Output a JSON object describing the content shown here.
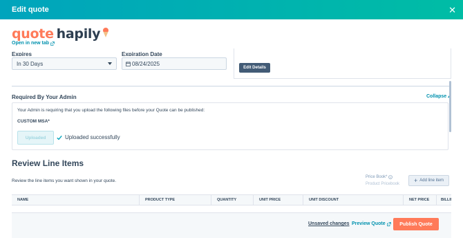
{
  "modal": {
    "title": "Edit quote"
  },
  "logo": {
    "word1": "quote",
    "word2": "hapily"
  },
  "open_new_tab": "Open in new tab",
  "expires": {
    "label": "Expires",
    "value": "In 30 Days"
  },
  "expiration_date": {
    "label": "Expiration Date",
    "value": "08/24/2025"
  },
  "details": {
    "edit_button": "Edit Details"
  },
  "required": {
    "title": "Required By Your Admin",
    "collapse": "Collapse",
    "description": "Your Admin is requiring that you upload the following files before your Quote can be published:",
    "file_label": "CUSTOM MSA*",
    "uploaded_button": "Uploaded",
    "status": "Uploaded successfully"
  },
  "review": {
    "title": "Review Line Items",
    "description": "Review the line items you want shown in your quote.",
    "price_book_label": "Price Book*",
    "price_book_value": "Product Pricebook",
    "add_line_item": "Add line item",
    "columns": [
      "NAME",
      "PRODUCT TYPE",
      "QUANTITY",
      "UNIT PRICE",
      "UNIT DISCOUNT",
      "NET PRICE",
      "BILLING"
    ]
  },
  "footer": {
    "unsaved": "Unsaved changes",
    "preview": "Preview Quote",
    "publish": "Publish Quote"
  },
  "colors": {
    "header_start": "#00a4bd",
    "header_end": "#00bda5",
    "accent": "#ff7a59",
    "link": "#0091ae",
    "dark_button": "#425b76"
  }
}
